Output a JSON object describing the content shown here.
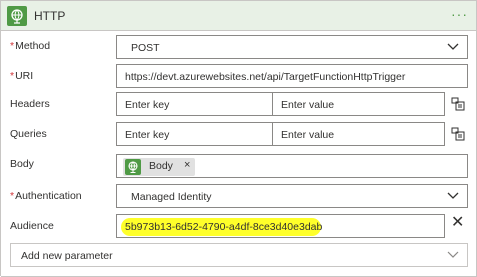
{
  "header": {
    "title": "HTTP",
    "more": "···"
  },
  "fields": {
    "method": {
      "label": "Method",
      "required": "*",
      "value": "POST"
    },
    "uri": {
      "label": "URI",
      "required": "*",
      "value": "https://devt.azurewebsites.net/api/TargetFunctionHttpTrigger"
    },
    "headers": {
      "label": "Headers",
      "key_placeholder": "Enter key",
      "value_placeholder": "Enter value"
    },
    "queries": {
      "label": "Queries",
      "key_placeholder": "Enter key",
      "value_placeholder": "Enter value"
    },
    "body": {
      "label": "Body",
      "token_label": "Body",
      "token_remove": "×"
    },
    "authentication": {
      "label": "Authentication",
      "required": "*",
      "value": "Managed Identity"
    },
    "audience": {
      "label": "Audience",
      "value": "5b973b13-6d52-4790-a4df-8ce3d40e3dab",
      "clear": "✕"
    }
  },
  "add_parameter": {
    "label": "Add new parameter"
  },
  "colors": {
    "accent": "#4f9a45",
    "header_bg": "#e8f1e6",
    "required": "#d13438",
    "highlight": "#ffff2a"
  },
  "icons": [
    "globe-icon",
    "more-icon",
    "chevron-down-icon",
    "switch-mode-icon",
    "close-icon"
  ]
}
